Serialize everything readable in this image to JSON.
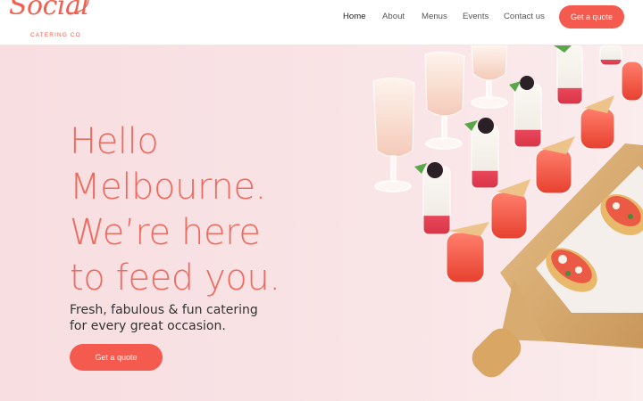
{
  "brand": {
    "logo_script": "Social",
    "logo_sub": "CATERING CO"
  },
  "nav": {
    "items": [
      {
        "label": "Home"
      },
      {
        "label": "About"
      },
      {
        "label": "Menus"
      },
      {
        "label": "Events"
      },
      {
        "label": "Contact us"
      }
    ],
    "active": "Home",
    "cta_label": "Get a quote"
  },
  "hero": {
    "headline_lines": [
      "Hello",
      "Melbourne.",
      "We’re here",
      "to feed you."
    ],
    "sub_lines": [
      "Fresh, fabulous & fun catering",
      "for every great occasion."
    ],
    "cta_label": "Get a quote"
  },
  "colors": {
    "accent": "#f55a4e",
    "headline": "#ef6a5e",
    "hero_bg": "#f9e2e4"
  }
}
